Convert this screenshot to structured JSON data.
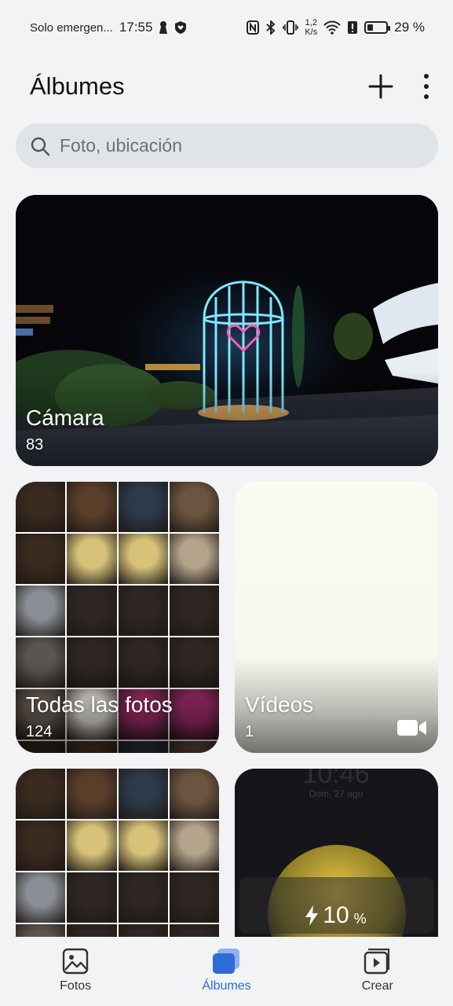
{
  "status_bar": {
    "carrier": "Solo emergen...",
    "time": "17:55",
    "speed_value": "1,2",
    "speed_unit": "K/s",
    "battery": "29 %",
    "battery_level": 0.29
  },
  "header": {
    "title": "Álbumes"
  },
  "search": {
    "placeholder": "Foto, ubicación"
  },
  "albums": [
    {
      "name": "Cámara",
      "count": "83"
    },
    {
      "name": "Todas las fotos",
      "count": "124"
    },
    {
      "name": "Vídeos",
      "count": "1"
    }
  ],
  "charge_widget": {
    "value": "10",
    "unit": "%"
  },
  "bottom_nav": {
    "items": [
      {
        "label": "Fotos",
        "icon": "photo-icon"
      },
      {
        "label": "Álbumes",
        "icon": "albums-icon",
        "active": true
      },
      {
        "label": "Crear",
        "icon": "create-icon"
      }
    ]
  },
  "colors": {
    "background": "#f1f3f5",
    "accent": "#2f6bd7",
    "search_bg": "#e1e4e7"
  }
}
